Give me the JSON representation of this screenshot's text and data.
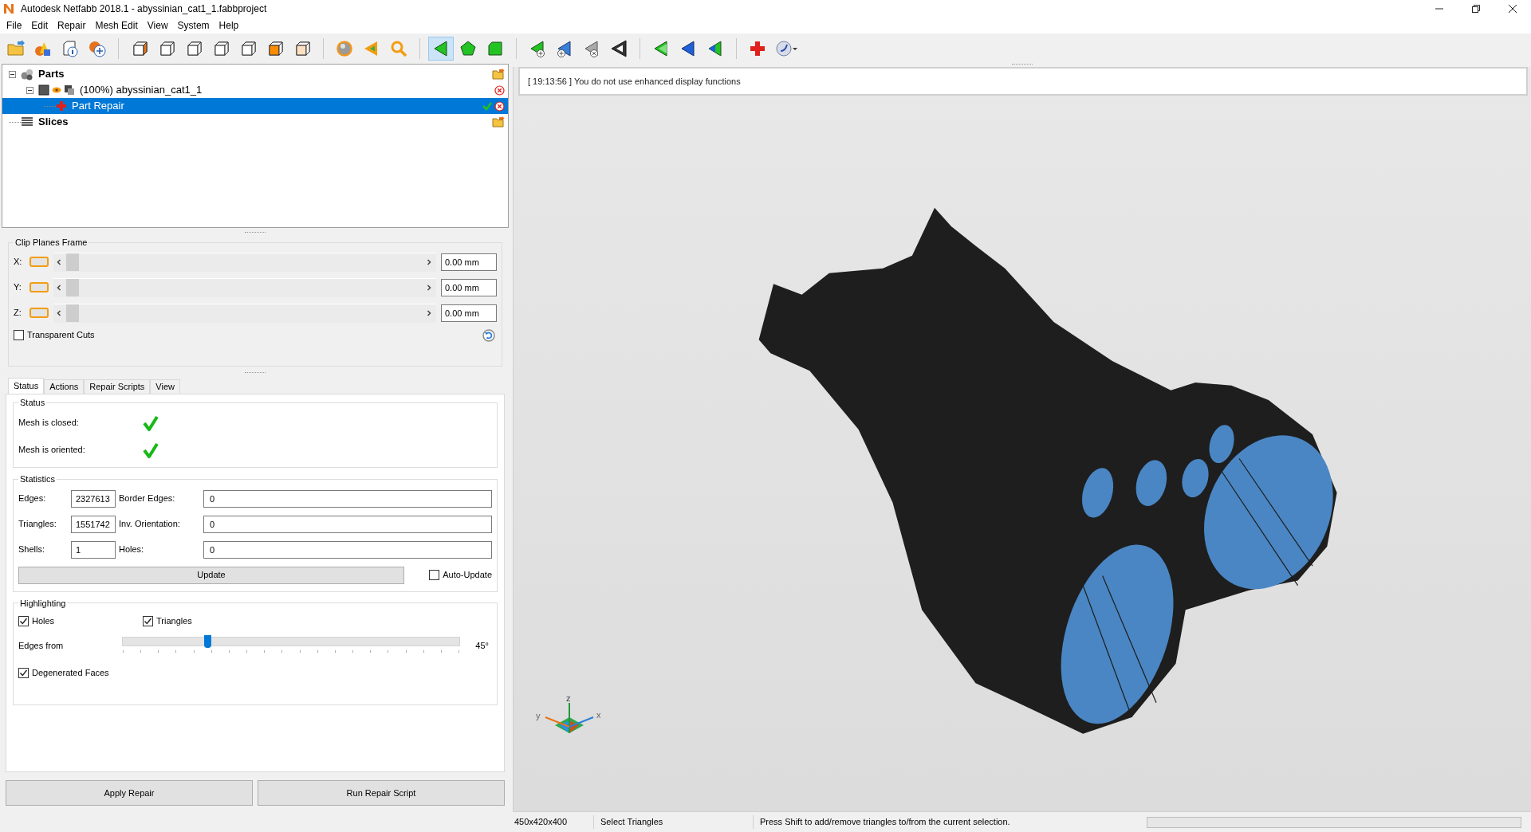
{
  "window": {
    "title": "Autodesk Netfabb 2018.1 - abyssinian_cat1_1.fabbproject"
  },
  "menu": [
    "File",
    "Edit",
    "Repair",
    "Mesh Edit",
    "View",
    "System",
    "Help"
  ],
  "toolbar_buttons": [
    {
      "kind": "open",
      "selected": false
    },
    {
      "kind": "shapes",
      "selected": false
    },
    {
      "kind": "info",
      "selected": false
    },
    {
      "kind": "add-part",
      "selected": false
    },
    {
      "kind": "cube-a",
      "selected": false
    },
    {
      "kind": "cube-b",
      "selected": false
    },
    {
      "kind": "cube-c",
      "selected": false
    },
    {
      "kind": "cube-d",
      "selected": false
    },
    {
      "kind": "cube-e",
      "selected": false
    },
    {
      "kind": "cube-f",
      "selected": false
    },
    {
      "kind": "cube-g",
      "selected": false
    },
    {
      "kind": "sphere",
      "selected": false
    },
    {
      "kind": "triangle-orange",
      "selected": false
    },
    {
      "kind": "zoom",
      "selected": false
    },
    {
      "kind": "triangle-select",
      "selected": true
    },
    {
      "kind": "pentagon",
      "selected": false
    },
    {
      "kind": "surface",
      "selected": false
    },
    {
      "kind": "triangle-add",
      "selected": false
    },
    {
      "kind": "triangle-add-blue",
      "selected": false
    },
    {
      "kind": "triangle-remove",
      "selected": false
    },
    {
      "kind": "triangle-dark",
      "selected": false
    },
    {
      "kind": "triangle-green",
      "selected": false
    },
    {
      "kind": "triangle-blue",
      "selected": false
    },
    {
      "kind": "triangle-green-b",
      "selected": false
    },
    {
      "kind": "repair",
      "selected": false
    },
    {
      "kind": "script",
      "selected": false
    }
  ],
  "tree": [
    {
      "label": "Parts",
      "kind": "group",
      "expanded": true,
      "selected": false,
      "children": [
        {
          "label": "(100%) abyssinian_cat1_1",
          "kind": "part",
          "expanded": true,
          "selected": false,
          "children": [
            {
              "label": "Part Repair",
              "kind": "repair",
              "selected": true
            }
          ]
        }
      ]
    },
    {
      "label": "Slices",
      "kind": "slices",
      "selected": false
    }
  ],
  "log": {
    "message": "[ 19:13:56 ] You do not use enhanced display functions"
  },
  "clip_planes": {
    "title": "Clip Planes Frame",
    "axes": [
      {
        "label": "X:",
        "value": "0.00 mm",
        "level": 0
      },
      {
        "label": "Y:",
        "value": "0.00 mm",
        "level": 0
      },
      {
        "label": "Z:",
        "value": "0.00 mm",
        "level": 0
      }
    ],
    "transparent_cuts": {
      "label": "Transparent Cuts",
      "checked": false
    }
  },
  "tabs": [
    {
      "label": "Status",
      "selected": true
    },
    {
      "label": "Actions",
      "selected": false
    },
    {
      "label": "Repair Scripts",
      "selected": false
    },
    {
      "label": "View",
      "selected": false
    }
  ],
  "status": {
    "title": "Status",
    "rows": [
      {
        "label": "Mesh is closed:",
        "ok": true
      },
      {
        "label": "Mesh is oriented:",
        "ok": true
      }
    ]
  },
  "statistics": {
    "title": "Statistics",
    "fields": [
      {
        "label": "Edges:",
        "value": "2327613",
        "label_2": "Border Edges:",
        "value_2": "0"
      },
      {
        "label": "Triangles:",
        "value": "1551742",
        "label_2": "Inv. Orientation:",
        "value_2": "0"
      },
      {
        "label": "Shells:",
        "value": "1",
        "label_2": "Holes:",
        "value_2": "0"
      }
    ],
    "update_button": "Update",
    "auto_update": {
      "label": "Auto-Update",
      "checked": false
    }
  },
  "highlighting": {
    "title": "Highlighting",
    "holes": {
      "label": "Holes",
      "checked": true
    },
    "triangles": {
      "label": "Triangles",
      "checked": true
    },
    "edges_from": {
      "label": "Edges from",
      "level": 0.25,
      "reading": "45°"
    },
    "degenerated_faces": {
      "label": "Degenerated Faces",
      "checked": true
    }
  },
  "buttons": [
    "Apply Repair",
    "Run Repair Script"
  ],
  "axis_labels": {
    "z": "z",
    "y": "y",
    "x": "x"
  },
  "status_bar": {
    "dimensions": "450x420x400",
    "mode": "Select Triangles",
    "hint": "Press Shift to add/remove triangles to/from the current selection."
  }
}
